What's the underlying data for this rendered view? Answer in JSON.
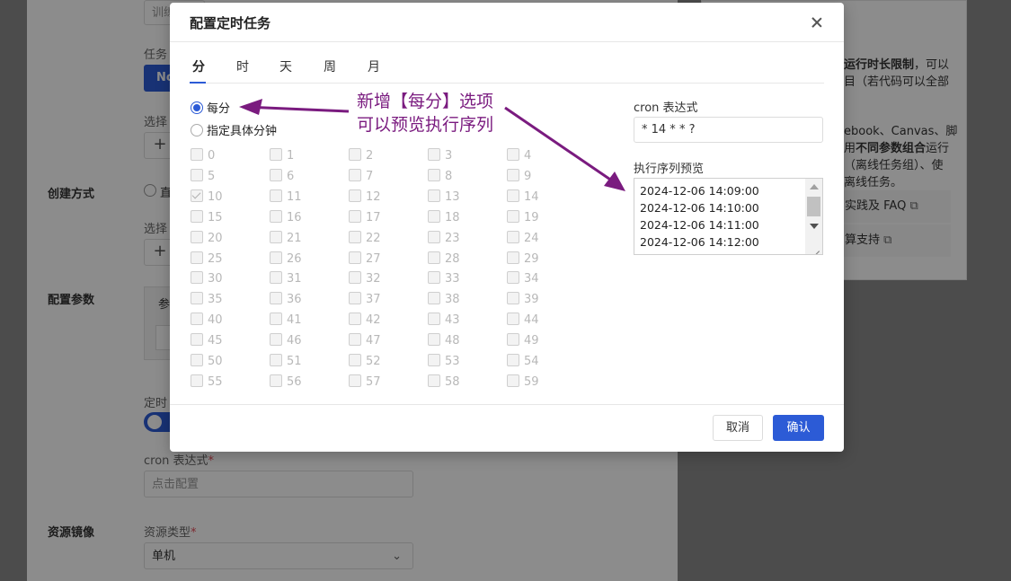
{
  "background": {
    "input_top_text": "训练",
    "task_label": "任务",
    "blue_btn_text": "No",
    "select_label_1": "选择",
    "create_mode_label": "创建方式",
    "create_mode_option": "直",
    "select_label_2": "选择",
    "config_params_label": "配置参数",
    "table_header": "参",
    "timer_label": "定时",
    "cron_label": "cron 表达式",
    "required_mark": "*",
    "cron_placeholder": "点击配置",
    "resource_image_label": "资源镜像",
    "resource_type_label": "资源类型",
    "resource_type_value": "单机",
    "side": {
      "line1_bold": "运行时长限制",
      "line1_rest": "，可以",
      "line2": "目（若代码可以全部",
      "line3": "ebook、Canvas、脚",
      "line4_a": "用",
      "line4_bold": "不同参数组合",
      "line4_b": "运行",
      "line5": "（离线任务组）、使",
      "line6": "离线任务。",
      "link1": "实践及 FAQ",
      "link2": "算支持"
    }
  },
  "modal": {
    "title": "配置定时任务",
    "tabs": [
      "分",
      "时",
      "天",
      "周",
      "月"
    ],
    "active_tab": "分",
    "radio_every": "每分",
    "radio_specific": "指定具体分钟",
    "minutes": [
      "0",
      "1",
      "2",
      "3",
      "4",
      "5",
      "6",
      "7",
      "8",
      "9",
      "10",
      "11",
      "12",
      "13",
      "14",
      "15",
      "16",
      "17",
      "18",
      "19",
      "20",
      "21",
      "22",
      "23",
      "24",
      "25",
      "26",
      "27",
      "28",
      "29",
      "30",
      "31",
      "32",
      "33",
      "34",
      "35",
      "36",
      "37",
      "38",
      "39",
      "40",
      "41",
      "42",
      "43",
      "44",
      "45",
      "46",
      "47",
      "48",
      "49",
      "50",
      "51",
      "52",
      "53",
      "54",
      "55",
      "56",
      "57",
      "58",
      "59"
    ],
    "checked_minute": "10",
    "cron_label": "cron 表达式",
    "cron_value": "* 14 * * ?",
    "sequence_label": "执行序列预览",
    "sequence": [
      "2024-12-06 14:09:00",
      "2024-12-06 14:10:00",
      "2024-12-06 14:11:00",
      "2024-12-06 14:12:00"
    ],
    "cancel": "取消",
    "ok": "确认"
  },
  "annotation": {
    "line1": "新增【每分】选项",
    "line2": "可以预览执行序列",
    "color": "#7a1b7f"
  },
  "colors": {
    "primary": "#2c5bd6",
    "overlay": "rgba(0,0,0,0.45)"
  }
}
